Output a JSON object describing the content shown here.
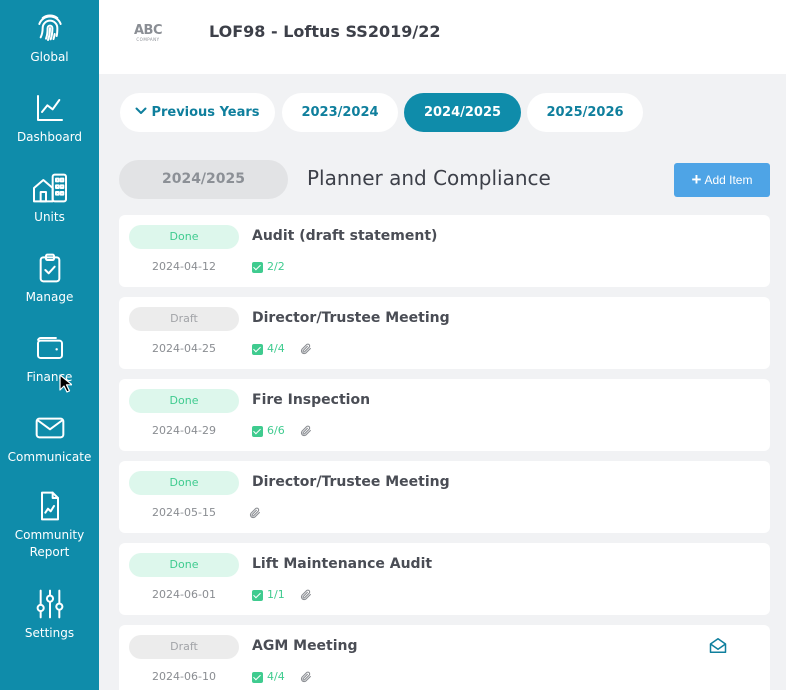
{
  "sidebar": {
    "items": [
      {
        "label": "Global",
        "icon": "fingerprint-icon"
      },
      {
        "label": "Dashboard",
        "icon": "line-chart-icon"
      },
      {
        "label": "Units",
        "icon": "buildings-icon"
      },
      {
        "label": "Manage",
        "icon": "clipboard-check-icon"
      },
      {
        "label": "Finance",
        "icon": "wallet-icon"
      },
      {
        "label": "Communicate",
        "icon": "envelope-icon"
      },
      {
        "label": "Community Report",
        "icon": "report-document-icon"
      },
      {
        "label": "Settings",
        "icon": "sliders-icon"
      }
    ]
  },
  "header": {
    "logo_text": "ABC",
    "logo_subtext": "COMPANY",
    "title": "LOF98 - Loftus SS2019/22"
  },
  "year_tabs": [
    {
      "label": "Previous Years",
      "active": false
    },
    {
      "label": "2023/2024",
      "active": false
    },
    {
      "label": "2024/2025",
      "active": true
    },
    {
      "label": "2025/2026",
      "active": false
    }
  ],
  "section": {
    "year": "2024/2025",
    "title": "Planner and Compliance",
    "add_button_label": "Add Item"
  },
  "items": [
    {
      "status": "Done",
      "date": "2024-04-12",
      "title": "Audit (draft statement)",
      "checklist": "2/2"
    },
    {
      "status": "Draft",
      "date": "2024-04-25",
      "title": "Director/Trustee Meeting",
      "checklist": "4/4"
    },
    {
      "status": "Done",
      "date": "2024-04-29",
      "title": "Fire Inspection",
      "checklist": "6/6"
    },
    {
      "status": "Done",
      "date": "2024-05-15",
      "title": "Director/Trustee Meeting"
    },
    {
      "status": "Done",
      "date": "2024-06-01",
      "title": "Lift Maintenance Audit",
      "checklist": "1/1"
    },
    {
      "status": "Draft",
      "date": "2024-06-10",
      "title": "AGM Meeting",
      "checklist": "4/4"
    }
  ],
  "colors": {
    "sidebar": "#0f8caa",
    "accent": "#0f7f9d",
    "done": "#3fcb8f",
    "add_button": "#4ea4e6"
  }
}
